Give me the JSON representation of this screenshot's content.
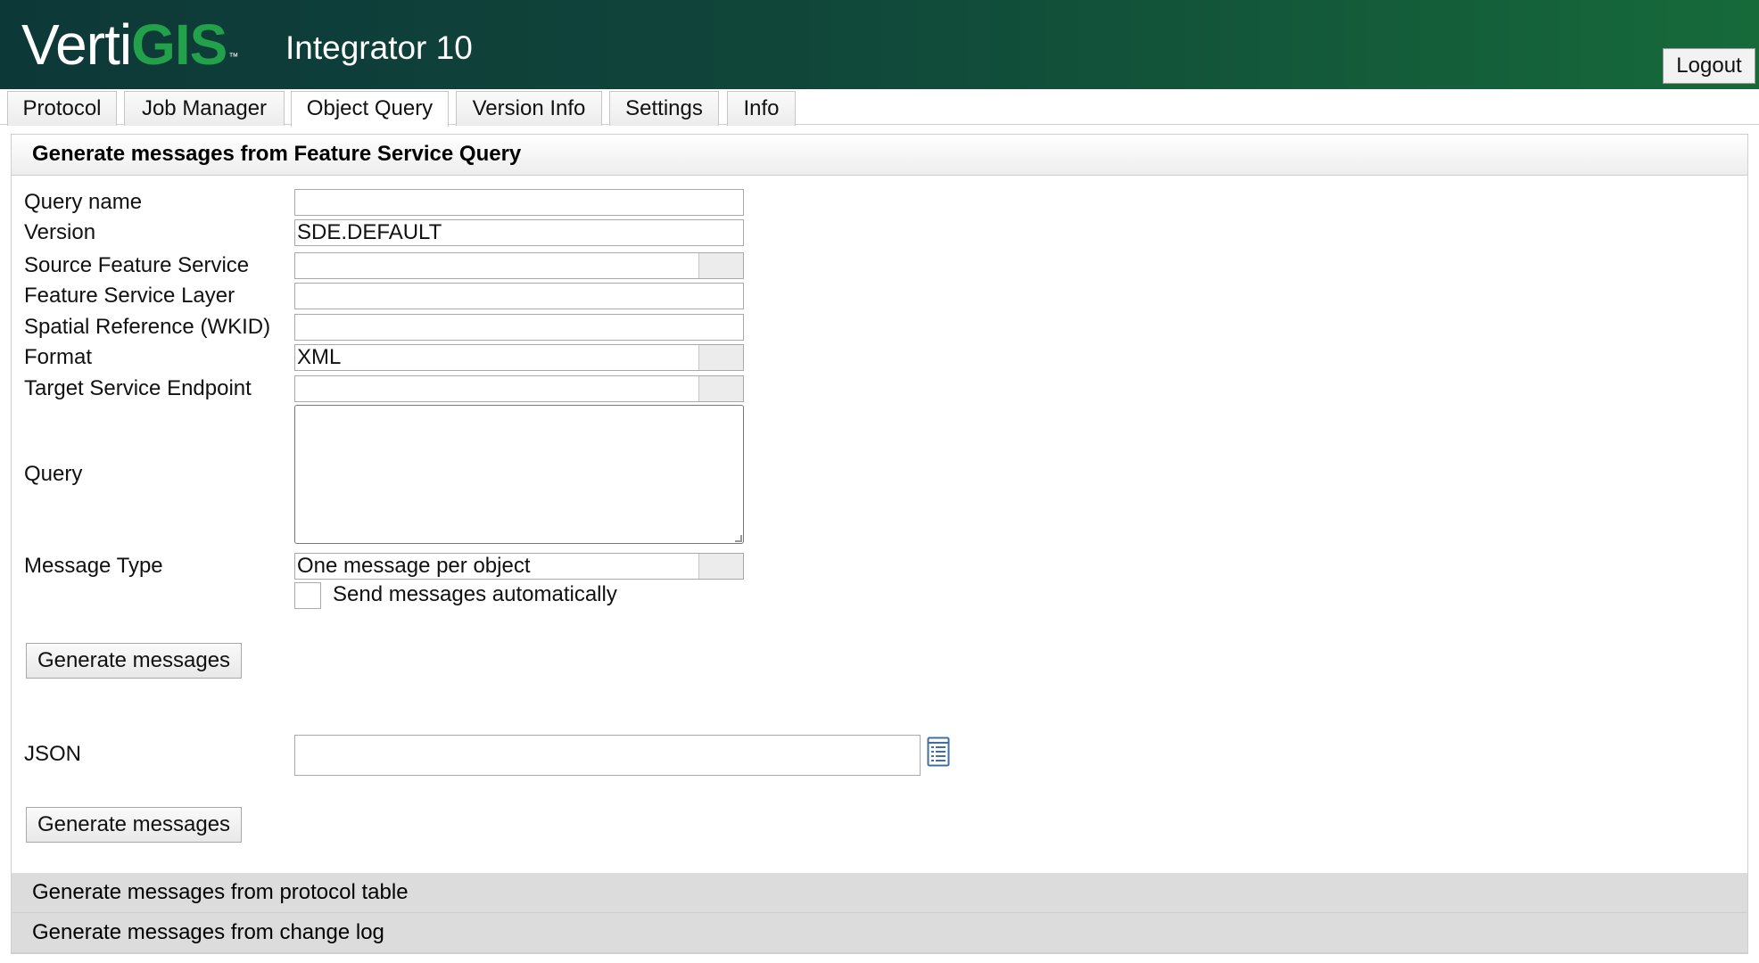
{
  "header": {
    "logo_part1": "Verti",
    "logo_part2": "GIS",
    "logo_tm": "™",
    "app_title": "Integrator 10",
    "logout_label": "Logout"
  },
  "tabs": [
    {
      "label": "Protocol"
    },
    {
      "label": "Job Manager"
    },
    {
      "label": "Object Query",
      "active": true
    },
    {
      "label": "Version Info"
    },
    {
      "label": "Settings"
    },
    {
      "label": "Info"
    }
  ],
  "section": {
    "title": "Generate messages from Feature Service Query"
  },
  "form": {
    "query_name": {
      "label": "Query name",
      "value": ""
    },
    "version": {
      "label": "Version",
      "value": "SDE.DEFAULT"
    },
    "source_feature_service": {
      "label": "Source Feature Service",
      "value": ""
    },
    "feature_service_layer": {
      "label": "Feature Service Layer",
      "value": ""
    },
    "spatial_reference": {
      "label": "Spatial Reference (WKID)",
      "value": ""
    },
    "format": {
      "label": "Format",
      "value": "XML"
    },
    "target_service_endpoint": {
      "label": "Target Service Endpoint",
      "value": ""
    },
    "query": {
      "label": "Query",
      "value": ""
    },
    "message_type": {
      "label": "Message Type",
      "value": "One message per object"
    },
    "send_automatically": {
      "label": "Send messages automatically",
      "checked": false
    },
    "generate_button_1": "Generate messages",
    "json": {
      "label": "JSON",
      "value": ""
    },
    "generate_button_2": "Generate messages"
  },
  "collapsed_sections": [
    {
      "title": "Generate messages from protocol table"
    },
    {
      "title": "Generate messages from change log"
    }
  ],
  "icons": {
    "json_picker": "document-list-icon",
    "combo_arrow": "dropdown-arrow-icon"
  },
  "colors": {
    "header_dark": "#0d3838",
    "header_light": "#166a3a",
    "brand_green": "#22a04a"
  }
}
